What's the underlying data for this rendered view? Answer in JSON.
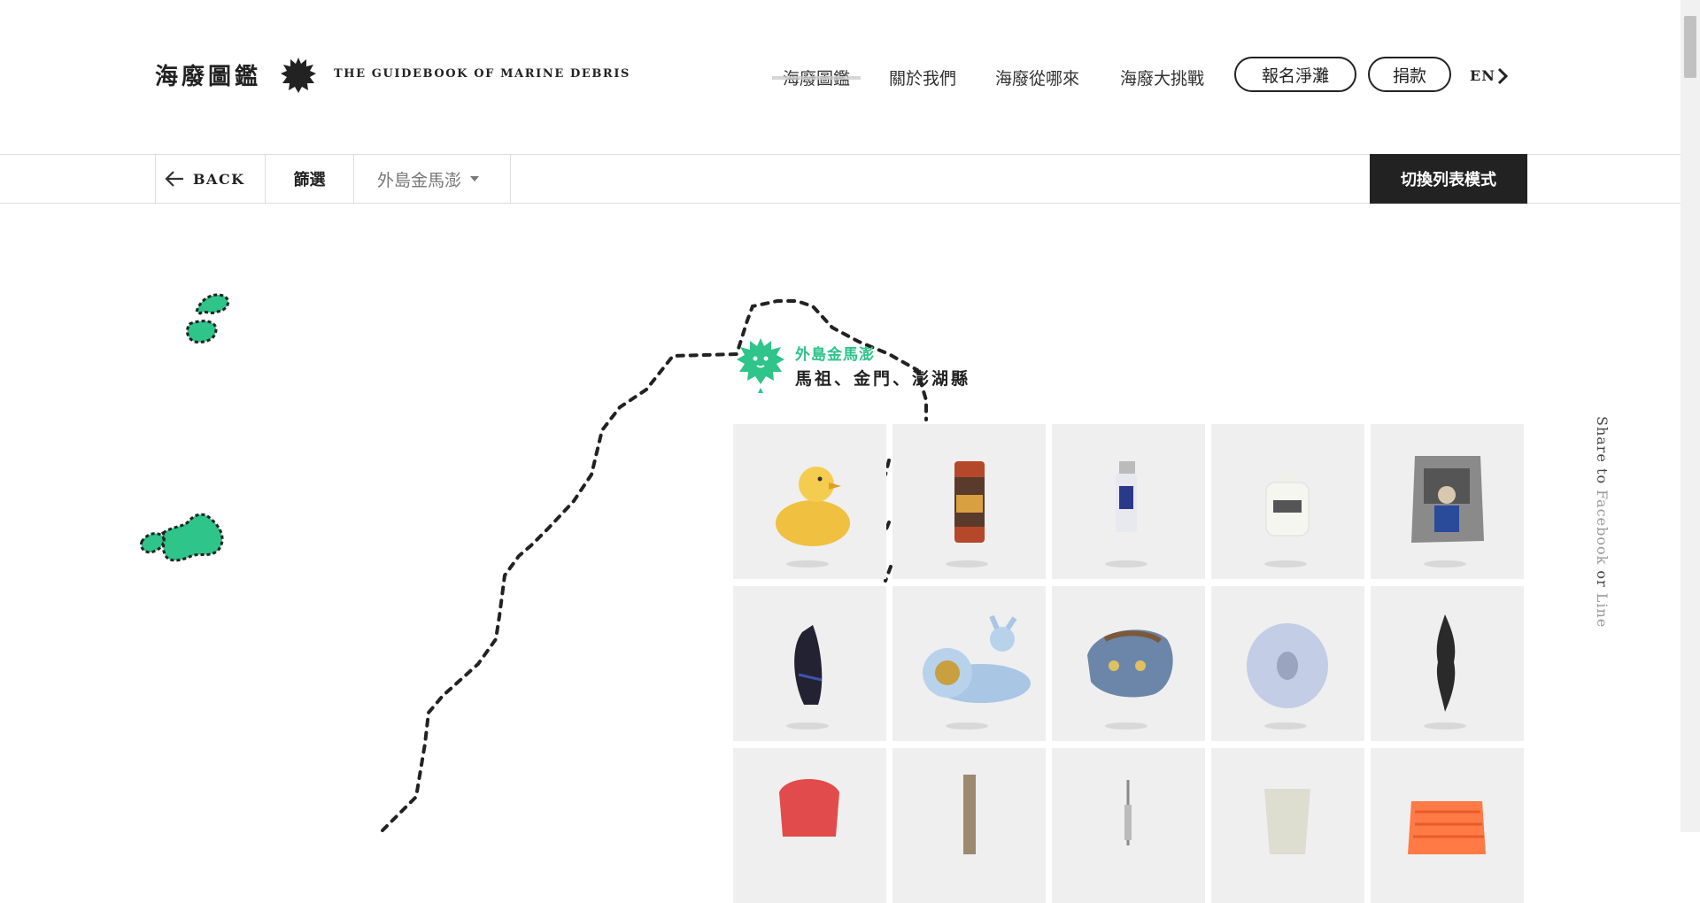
{
  "header": {
    "logo_cn": "海廢圖鑑",
    "logo_en": "THE GUIDEBOOK OF MARINE DEBRIS",
    "nav": [
      {
        "label": "海廢圖鑑",
        "active": true
      },
      {
        "label": "關於我們",
        "active": false
      },
      {
        "label": "海廢從哪來",
        "active": false
      },
      {
        "label": "海廢大挑戰",
        "active": false
      }
    ],
    "register_button": "報名淨灘",
    "donate_button": "捐款",
    "lang": "EN"
  },
  "toolbar": {
    "back_label": "BACK",
    "filter_label": "篩選",
    "region_select": "外島金馬澎",
    "switch_button": "切換列表模式"
  },
  "region": {
    "name": "外島金馬澎",
    "areas": "馬祖、金門、澎湖縣",
    "accent_color": "#2ec48a"
  },
  "items": [
    {
      "icon": "rubber-duck-icon",
      "color": "#f0c040"
    },
    {
      "icon": "can-icon",
      "color": "#b5482a"
    },
    {
      "icon": "lighter-icon",
      "color": "#9aa6c8"
    },
    {
      "icon": "bottle-icon",
      "color": "#f5f5f0"
    },
    {
      "icon": "snack-bag-icon",
      "color": "#8a8a8a"
    },
    {
      "icon": "cable-bundle-icon",
      "color": "#222233"
    },
    {
      "icon": "snail-toy-icon",
      "color": "#a9c6e4"
    },
    {
      "icon": "slipper-icon",
      "color": "#6b86a8"
    },
    {
      "icon": "spool-icon",
      "color": "#c3cde6"
    },
    {
      "icon": "black-fragment-icon",
      "color": "#2a2a2a"
    },
    {
      "icon": "red-basket-icon",
      "color": "#e24b4b"
    },
    {
      "icon": "stick-icon",
      "color": "#9b8a6e"
    },
    {
      "icon": "syringe-icon",
      "color": "#8a8a8a"
    },
    {
      "icon": "cup-icon",
      "color": "#ddddd0"
    },
    {
      "icon": "orange-crate-icon",
      "color": "#ff7a45"
    }
  ],
  "share": {
    "prefix": "Share to ",
    "facebook": "Facebook",
    "or": " or ",
    "line": "Line"
  }
}
